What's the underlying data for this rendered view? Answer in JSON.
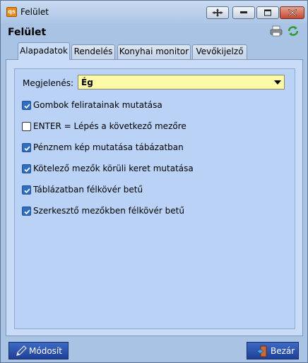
{
  "window": {
    "title": "Felület",
    "app_icon_text": "qs"
  },
  "header": {
    "title": "Felület"
  },
  "tabs": [
    {
      "label": "Alapadatok",
      "active": true
    },
    {
      "label": "Rendelés",
      "active": false
    },
    {
      "label": "Konyhai monitor",
      "active": false
    },
    {
      "label": "Vevőkijelző",
      "active": false
    }
  ],
  "form": {
    "megjelenes_label": "Megjelenés:",
    "megjelenes_value": "Ég",
    "checkboxes": [
      {
        "label": "Gombok feliratainak mutatása",
        "checked": true
      },
      {
        "label": "ENTER = Lépés a következő mezőre",
        "checked": false
      },
      {
        "label": "Pénznem kép mutatása tábázatban",
        "checked": true
      },
      {
        "label": "Kötelező mezők körüli keret mutatása",
        "checked": true
      },
      {
        "label": "Táblázatban félkövér betű",
        "checked": true
      },
      {
        "label": "Szerkesztő mezőkben félkövér betű",
        "checked": true
      }
    ]
  },
  "buttons": {
    "modosit": "Módosít",
    "bezar": "Bezár"
  },
  "icons": {
    "move": "move-icon",
    "minimize": "minimize-icon",
    "maximize": "maximize-icon",
    "close": "close-icon",
    "print": "printer-icon",
    "refresh": "refresh-icon",
    "edit": "pencil-icon",
    "exit": "exit-door-icon"
  },
  "colors": {
    "window_bg": "#a9c3e4",
    "panel_bg": "#c9dcf7",
    "select_bg": "#fdf9a6",
    "checkbox_on": "#2f6fc1",
    "button_bg": "#2b50ad",
    "close_button": "#c34a31"
  }
}
